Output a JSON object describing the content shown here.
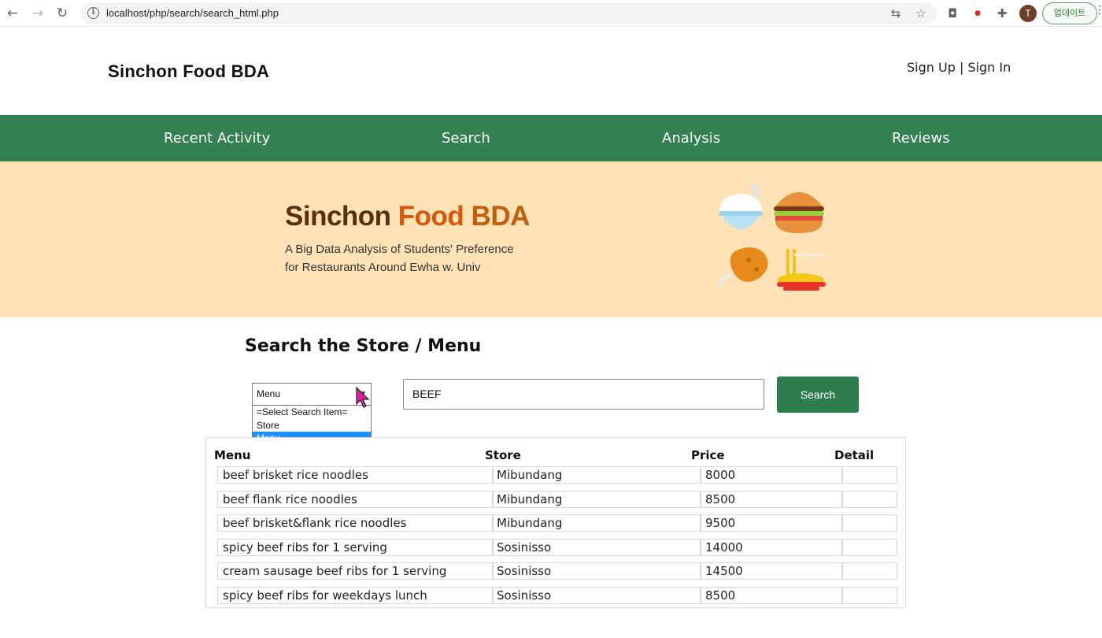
{
  "browser": {
    "url": "localhost/php/search/search_html.php",
    "avatar_letter": "T",
    "update_label": "업데이트"
  },
  "header": {
    "site_title": "Sinchon Food BDA",
    "sign_up": "Sign Up",
    "separator": " | ",
    "sign_in": "Sign In"
  },
  "nav": {
    "items": [
      {
        "label": "Recent Activity"
      },
      {
        "label": "Search"
      },
      {
        "label": "Analysis"
      },
      {
        "label": "Reviews"
      }
    ]
  },
  "banner": {
    "title_part1": "Sinchon ",
    "title_part2": "Food",
    "title_part3": " BDA",
    "subtitle_line1": "A Big Data Analysis of Students' Preference",
    "subtitle_line2": "for Restaurants Around Ewha w. Univ"
  },
  "search": {
    "heading": "Search the Store / Menu",
    "select_value": "Menu",
    "options": [
      "=Select Search Item=",
      "Store",
      "Menu"
    ],
    "query": "BEEF",
    "button_label": "Search"
  },
  "results": {
    "columns": [
      "Menu",
      "Store",
      "Price",
      "Detail"
    ],
    "rows": [
      {
        "menu": "beef brisket rice noodles",
        "store": "Mibundang",
        "price": "8000",
        "detail": ""
      },
      {
        "menu": "beef flank rice noodles",
        "store": "Mibundang",
        "price": "8500",
        "detail": ""
      },
      {
        "menu": "beef brisket&flank rice noodles",
        "store": "Mibundang",
        "price": "9500",
        "detail": ""
      },
      {
        "menu": "spicy beef ribs for 1 serving",
        "store": "Sosinisso",
        "price": "14000",
        "detail": ""
      },
      {
        "menu": "cream sausage beef ribs for 1 serving",
        "store": "Sosinisso",
        "price": "14500",
        "detail": ""
      },
      {
        "menu": "spicy beef ribs for weekdays lunch",
        "store": "Sosinisso",
        "price": "8500",
        "detail": ""
      }
    ]
  },
  "colors": {
    "nav_green": "#338050",
    "banner_bg": "#fce2b4",
    "button_green": "#2e7d4f",
    "selected_option": "#1e90ff"
  }
}
